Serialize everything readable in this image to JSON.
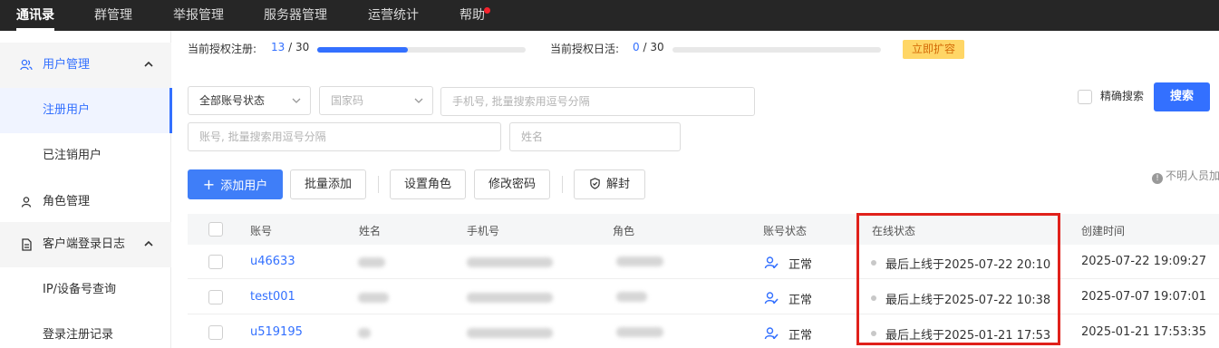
{
  "nav": {
    "items": [
      "通讯录",
      "群管理",
      "举报管理",
      "服务器管理",
      "运营统计",
      "帮助"
    ]
  },
  "sidebar": {
    "user_mgmt": "用户管理",
    "registered": "注册用户",
    "cancelled": "已注销用户",
    "role_mgmt": "角色管理",
    "client_log": "客户端登录日志",
    "ip_query": "IP/设备号查询",
    "reg_records": "登录注册记录"
  },
  "stats": {
    "reg_label": "当前授权注册:",
    "reg_used": "13",
    "reg_total": "/ 30",
    "reg_progress": 0.433,
    "daily_label": "当前授权日活:",
    "daily_used": "0",
    "daily_total": "/ 30",
    "daily_progress": 0.0,
    "expand": "立即扩容"
  },
  "filters": {
    "account_status": "全部账号状态",
    "country_code": "国家码",
    "phone_placeholder": "手机号, 批量搜索用逗号分隔",
    "account_placeholder": "账号, 批量搜索用逗号分隔",
    "name_placeholder": "姓名",
    "precise": "精确搜索",
    "search": "搜索"
  },
  "actions": {
    "add_user": "添加用户",
    "bulk_add": "批量添加",
    "set_role": "设置角色",
    "change_pwd": "修改密码",
    "unblock": "解封",
    "hint": "不明人员加"
  },
  "table": {
    "headers": [
      "账号",
      "姓名",
      "手机号",
      "角色",
      "账号状态",
      "在线状态",
      "创建时间"
    ],
    "rows": [
      {
        "account": "u46633",
        "status": "正常",
        "online": "最后上线于2025-07-22 20:10",
        "created": "2025-07-22 19:09:27"
      },
      {
        "account": "test001",
        "status": "正常",
        "online": "最后上线于2025-07-22 10:38",
        "created": "2025-07-07 19:07:01"
      },
      {
        "account": "u519195",
        "status": "正常",
        "online": "最后上线于2025-01-21 17:53",
        "created": "2025-01-21 17:53:35"
      }
    ]
  },
  "colors": {
    "primary": "#3370ff",
    "nav_bg": "#262626",
    "highlight": "#e0211b",
    "expand_bg": "#ffd666"
  }
}
